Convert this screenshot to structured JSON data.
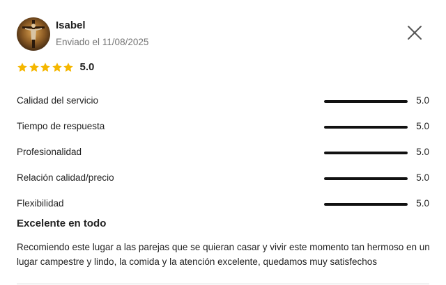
{
  "review": {
    "author": "Isabel",
    "sent_text": "Enviado el 11/08/2025",
    "overall_score": "5.0",
    "overall_stars": 5,
    "title": "Excelente en todo",
    "body": "Recomiendo este lugar a las parejas que se quieran casar y vivir este momento tan hermoso en un lugar campestre y lindo, la comida y la atención excelente, quedamos muy satisfechos"
  },
  "ratings": [
    {
      "label": "Calidad del servicio",
      "value": "5.0",
      "fraction": 1.0
    },
    {
      "label": "Tiempo de respuesta",
      "value": "5.0",
      "fraction": 1.0
    },
    {
      "label": "Profesionalidad",
      "value": "5.0",
      "fraction": 1.0
    },
    {
      "label": "Relación calidad/precio",
      "value": "5.0",
      "fraction": 1.0
    },
    {
      "label": "Flexibilidad",
      "value": "5.0",
      "fraction": 1.0
    }
  ],
  "icons": {
    "close": "close-icon",
    "star": "star-icon"
  },
  "colors": {
    "star": "#f5b700",
    "bar": "#111111",
    "secondary_text": "#757575"
  }
}
